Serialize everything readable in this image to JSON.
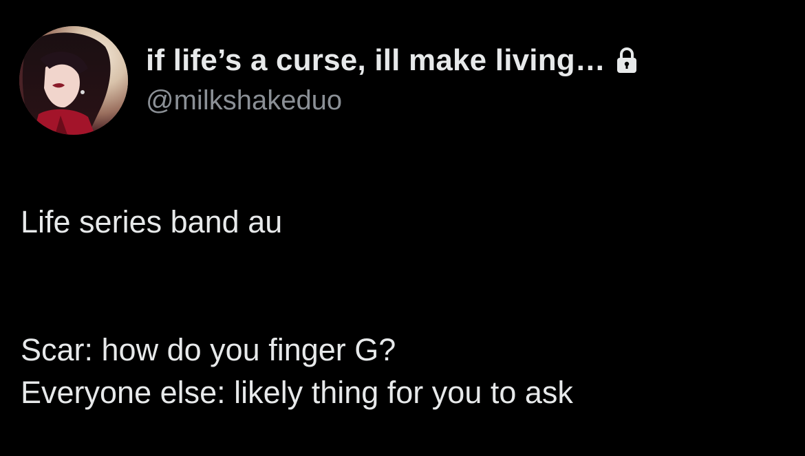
{
  "header": {
    "display_name": "if life’s a curse, ill make living…",
    "handle": "@milkshakeduo",
    "protected_icon": "lock-icon",
    "avatar_icon": "profile-avatar"
  },
  "tweet": {
    "line_1": "Life series band au",
    "line_2": "Scar: how do you finger G?",
    "line_3": "Everyone else: likely thing for you to ask"
  },
  "colors": {
    "background": "#000000",
    "primary_text": "#e7e9ea",
    "secondary_text": "#8b9096"
  }
}
